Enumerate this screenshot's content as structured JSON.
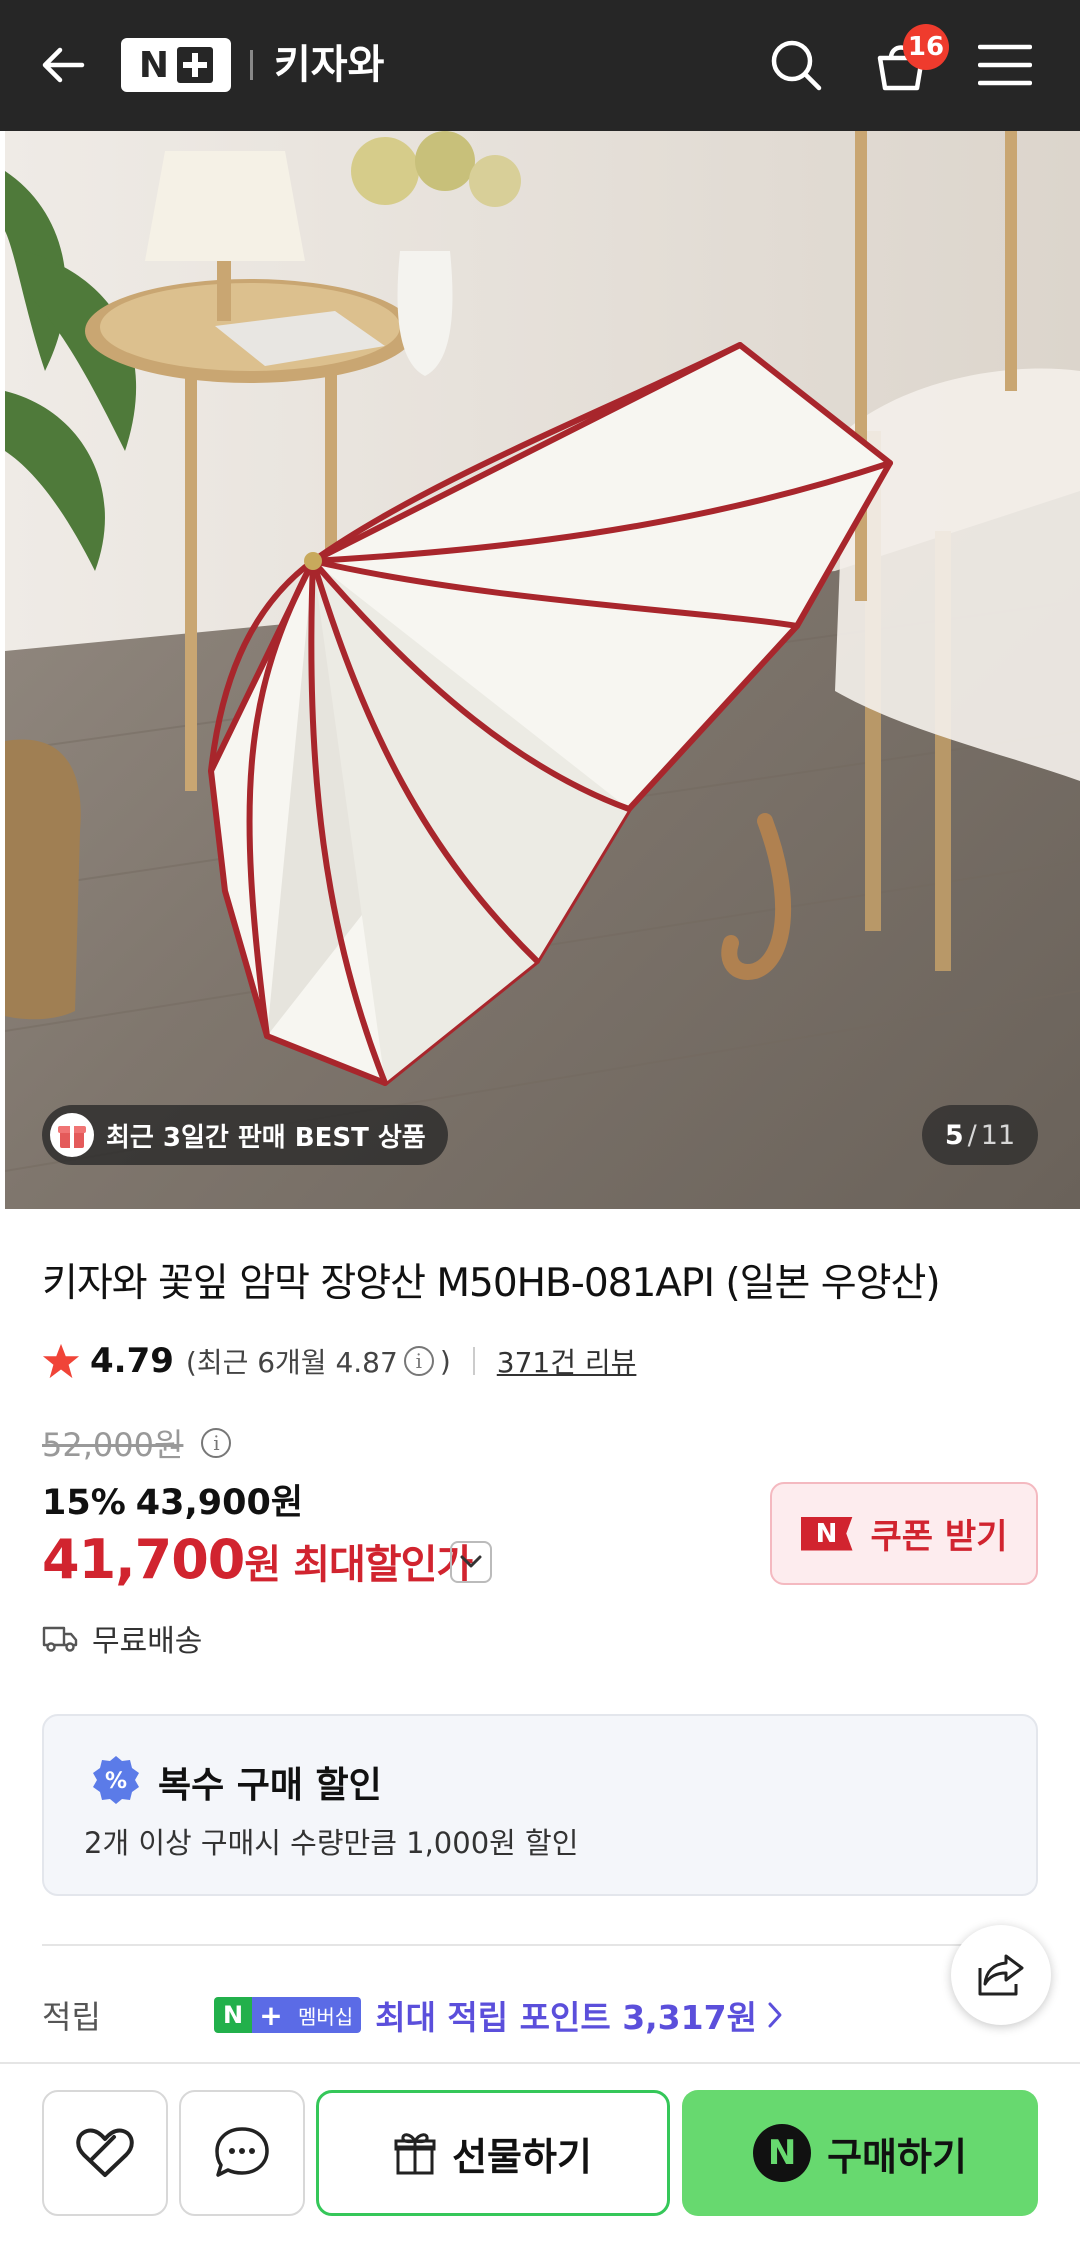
{
  "header": {
    "logo_letter": "N",
    "store_name": "키자와",
    "cart_count": "16"
  },
  "image": {
    "badge_text": "최근 3일간 판매 BEST 상품",
    "current_page": "5",
    "page_separator": "/",
    "total_pages": "11"
  },
  "product": {
    "title": "키자와 꽃잎 암막 장양산 M50HB-081API (일본 우양산)",
    "rating": "4.79",
    "recent_rating_prefix": "(최근 6개월 4.87",
    "recent_rating_suffix": ")",
    "reviews_link": "371건 리뷰"
  },
  "price": {
    "original": "52,000원",
    "discount_percent": "15%",
    "sale_price": "43,900원",
    "final_price": "41,700",
    "final_unit": "원",
    "final_label": "최대할인가",
    "coupon_label": "쿠폰 받기",
    "coupon_badge": "N"
  },
  "shipping": {
    "text": "무료배송"
  },
  "bulk_discount": {
    "icon_text": "%",
    "title": "복수 구매 할인",
    "description": "2개 이상 구매시 수량만큼 1,000원 할인"
  },
  "points": {
    "label": "적립",
    "badge_n": "N",
    "badge_plus": "+",
    "badge_member": "멤버십",
    "text": "최대 적립 포인트 3,317원"
  },
  "bottom_bar": {
    "gift_label": "선물하기",
    "buy_badge": "N",
    "buy_label": "구매하기"
  },
  "colors": {
    "header_bg": "#262626",
    "sale_red": "#d1242f",
    "buy_green": "#67d96f",
    "points_purple": "#5b4fdb",
    "cart_badge": "#ef3b2d"
  }
}
